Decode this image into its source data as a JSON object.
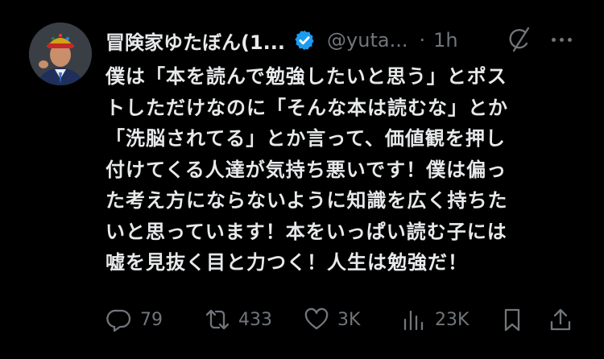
{
  "author": {
    "display_name": "冒険家ゆたぼん(1...",
    "handle": "@yuta...",
    "separator": "·",
    "time": "1h"
  },
  "body_lines": [
    "僕は「本を読んで勉強したいと思う」とポス",
    "トしただけなのに「そんな本は読むな」とか",
    "「洗脳されてる」とか言って、価値観を押し",
    "付けてくる人達が気持ち悪いです！僕は偏っ",
    "た考え方にならないように知識を広く持ちた",
    "いと思っています！本をいっぱい読む子には",
    "嘘を見抜く目と力つく！人生は勉強だ！"
  ],
  "actions": {
    "replies": "79",
    "reposts": "433",
    "likes": "3K",
    "views": "23K"
  },
  "colors": {
    "background": "#000000",
    "text": "#e7e9ea",
    "secondary": "#71767b",
    "verified": "#1d9bf0"
  },
  "icons": [
    "verified-badge-icon",
    "grok-icon",
    "more-icon",
    "reply-icon",
    "repost-icon",
    "like-icon",
    "views-icon",
    "bookmark-icon",
    "share-icon"
  ]
}
